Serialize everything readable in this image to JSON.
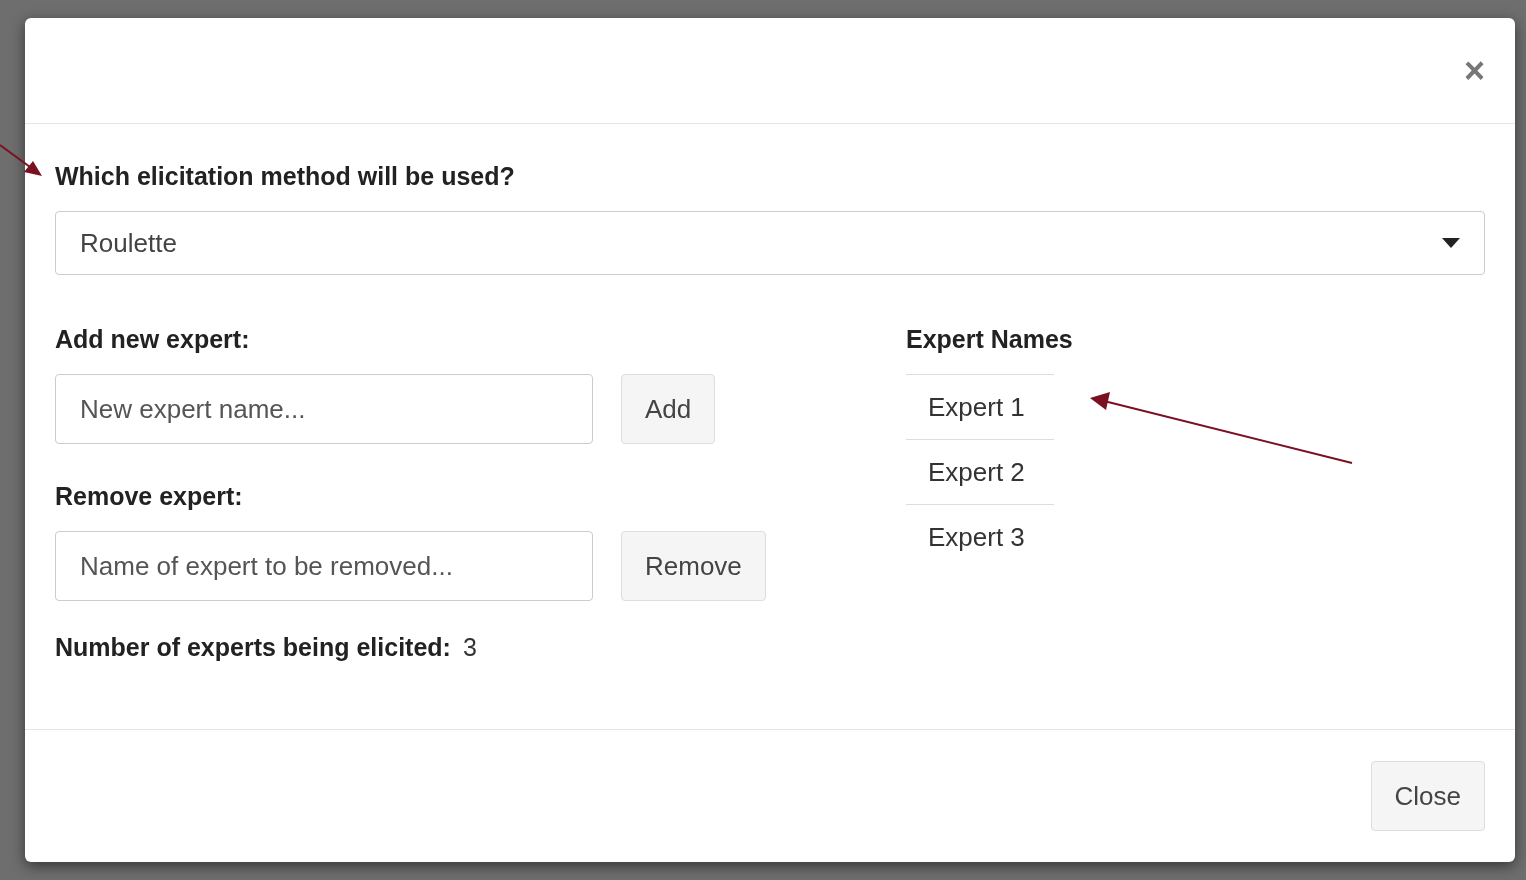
{
  "dialog": {
    "close_icon": "×",
    "method_label": "Which elicitation method will be used?",
    "method_value": "Roulette",
    "add_label": "Add new expert:",
    "add_placeholder": "New expert name...",
    "add_button": "Add",
    "remove_label": "Remove expert:",
    "remove_placeholder": "Name of expert to be removed...",
    "remove_button": "Remove",
    "count_label": "Number of experts being elicited:",
    "count_value": "3",
    "names_heading": "Expert Names",
    "names": [
      "Expert 1",
      "Expert 2",
      "Expert 3"
    ],
    "footer_button": "Close"
  }
}
